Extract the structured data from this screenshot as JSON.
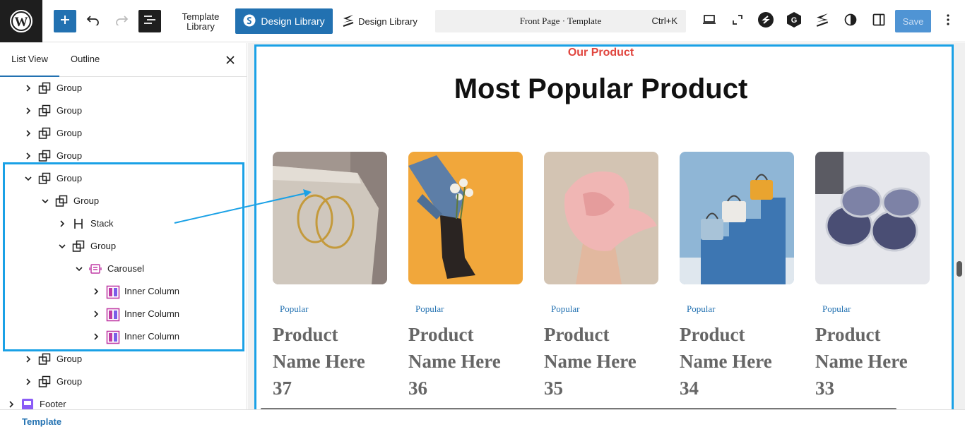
{
  "toolbar": {
    "template_library_line1": "Template",
    "template_library_line2": "Library",
    "design_library_primary": "Design Library",
    "design_library_secondary": "Design Library",
    "command_title": "Front Page · Template",
    "command_shortcut": "Ctrl+K",
    "save_label": "Save",
    "accent": "#2271b1",
    "icons": [
      "wordpress-logo-icon",
      "plus-icon",
      "undo-icon",
      "redo-icon",
      "document-overview-icon",
      "spectra-icon",
      "stackable-icon",
      "laptop-icon",
      "fullscreen-icon",
      "plugin-s-icon",
      "plugin-g-icon",
      "stackable-icon",
      "contrast-icon",
      "sidebar-icon",
      "more-vertical-icon"
    ]
  },
  "sidebar": {
    "tabs": [
      "List View",
      "Outline"
    ],
    "active_tab": "List View",
    "tree": [
      {
        "label": "Group",
        "icon": "group-icon",
        "expanded": false
      },
      {
        "label": "Group",
        "icon": "group-icon",
        "expanded": false
      },
      {
        "label": "Group",
        "icon": "group-icon",
        "expanded": false
      },
      {
        "label": "Group",
        "icon": "group-icon",
        "expanded": false
      },
      {
        "label": "Group",
        "icon": "group-icon",
        "expanded": true
      },
      {
        "label": "Group",
        "icon": "group-icon",
        "expanded": true
      },
      {
        "label": "Stack",
        "icon": "stack-icon",
        "expanded": false
      },
      {
        "label": "Group",
        "icon": "group-icon",
        "expanded": true
      },
      {
        "label": "Carousel",
        "icon": "carousel-icon",
        "expanded": true
      },
      {
        "label": "Inner Column",
        "icon": "inner-column-icon",
        "expanded": false
      },
      {
        "label": "Inner Column",
        "icon": "inner-column-icon",
        "expanded": false
      },
      {
        "label": "Inner Column",
        "icon": "inner-column-icon",
        "expanded": false
      },
      {
        "label": "Group",
        "icon": "group-icon",
        "expanded": false
      },
      {
        "label": "Group",
        "icon": "group-icon",
        "expanded": false
      },
      {
        "label": "Footer",
        "icon": "footer-icon",
        "expanded": false
      }
    ]
  },
  "status": {
    "breadcrumb": "Template"
  },
  "canvas": {
    "eyebrow": "Our Product",
    "heading": "Most Popular Product",
    "eyebrow_color": "#e0453e",
    "cards": [
      {
        "badge": "Popular",
        "name": "Product Name Here 37",
        "image": "gold-hoop-earrings"
      },
      {
        "badge": "Popular",
        "name": "Product Name Here 36",
        "image": "boots-with-flowers"
      },
      {
        "badge": "Popular",
        "name": "Product Name Here 35",
        "image": "pink-scarf-portrait"
      },
      {
        "badge": "Popular",
        "name": "Product Name Here 34",
        "image": "handbags-on-steps"
      },
      {
        "badge": "Popular",
        "name": "Product Name Here 33",
        "image": "sunglasses"
      }
    ]
  }
}
